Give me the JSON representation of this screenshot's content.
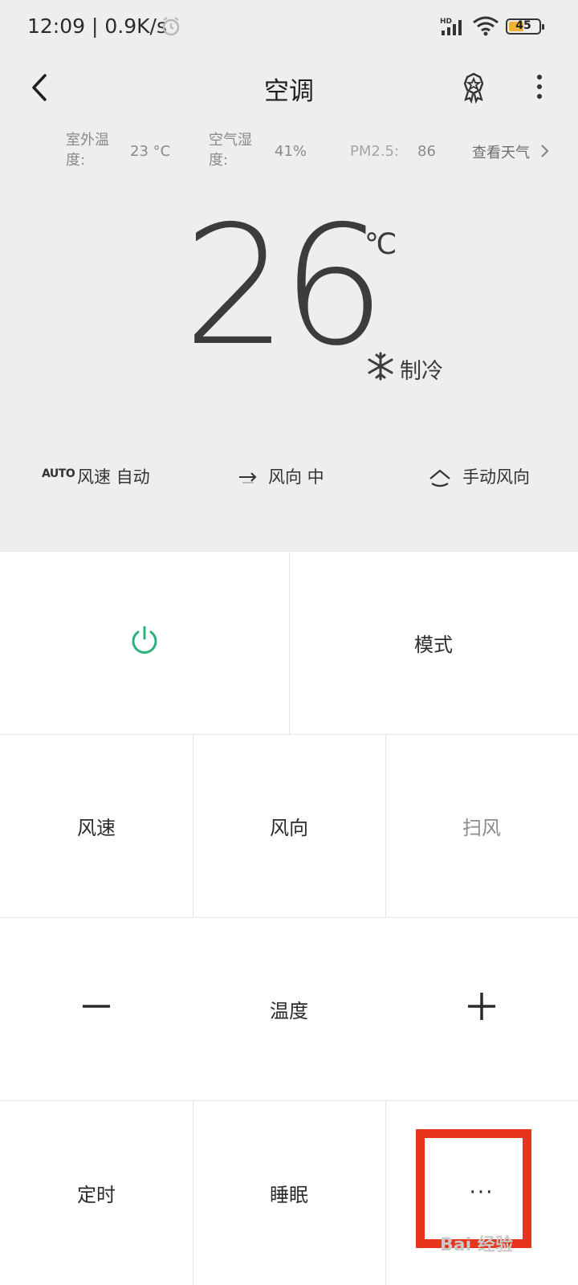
{
  "status_bar": {
    "time": "12:09 | 0.9K/s",
    "battery": "45",
    "network_badge": "HD"
  },
  "header": {
    "title": "空调",
    "back_icon": "back-arrow-icon",
    "badge_icon": "award-badge-icon",
    "more_icon": "vertical-dots-icon"
  },
  "weather": {
    "outdoor_temp_label": "室外温度:",
    "outdoor_temp_value": "23 °C",
    "humidity_label": "空气湿度:",
    "humidity_value": "41%",
    "pm_label": "PM2.5:",
    "pm_value": "86",
    "link": "查看天气"
  },
  "display": {
    "temperature": "26",
    "unit": "℃",
    "mode": "制冷"
  },
  "status_strip": {
    "auto_badge": "AUTO",
    "fan_speed": "风速 自动",
    "direction": "风向 中",
    "manual": "手动风向"
  },
  "controls": {
    "mode": "模式",
    "fan_speed": "风速",
    "direction": "风向",
    "sweep": "扫风",
    "temperature": "温度",
    "timer": "定时",
    "sleep": "睡眠",
    "more": "···"
  },
  "colors": {
    "power_green": "#27b57a",
    "highlight_red": "#e8341c",
    "panel_bg": "#eeeeee"
  },
  "watermark": "Bai 经验"
}
